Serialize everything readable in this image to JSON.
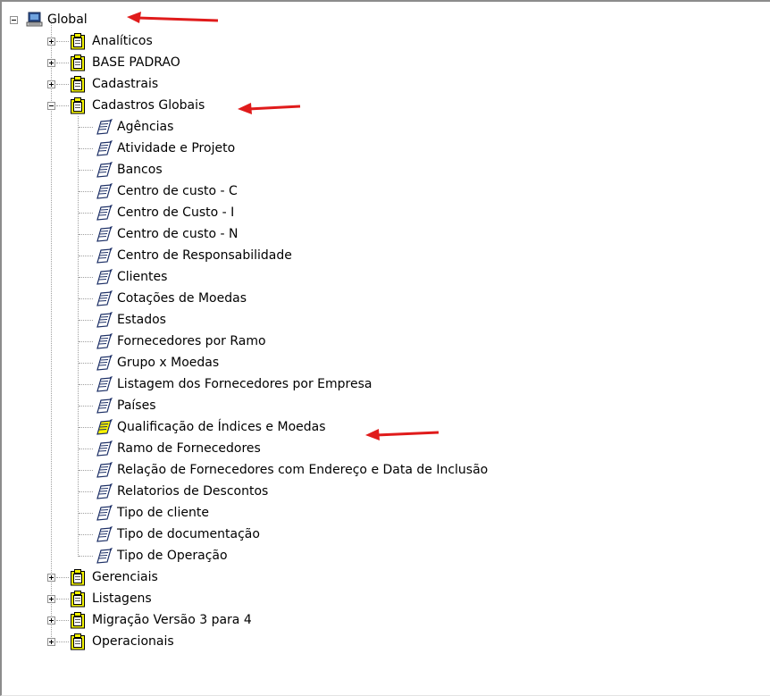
{
  "tree": {
    "root": {
      "label": "Global",
      "icon": "computer-icon",
      "expanded": true
    },
    "folders": [
      {
        "label": "Analíticos",
        "expanded": false
      },
      {
        "label": "BASE PADRAO",
        "expanded": false
      },
      {
        "label": "Cadastrais",
        "expanded": false
      },
      {
        "label": "Cadastros Globais",
        "expanded": true
      },
      {
        "label": "Gerenciais",
        "expanded": false
      },
      {
        "label": "Listagens",
        "expanded": false
      },
      {
        "label": "Migração Versão 3 para 4",
        "expanded": false
      },
      {
        "label": "Operacionais",
        "expanded": false
      }
    ],
    "reports": [
      "Agências",
      "Atividade e Projeto",
      "Bancos",
      "Centro de custo - C",
      "Centro de Custo - I",
      "Centro de custo - N",
      "Centro de Responsabilidade",
      "Clientes",
      "Cotações de Moedas",
      "Estados",
      "Fornecedores por Ramo",
      "Grupo x Moedas",
      "Listagem dos Fornecedores por Empresa",
      "Países",
      "Qualificação de Índices e Moedas",
      "Ramo de Fornecedores",
      "Relação de Fornecedores com Endereço e Data de Inclusão",
      "Relatorios de Descontos",
      "Tipo de cliente",
      "Tipo de documentação",
      "Tipo de Operação"
    ],
    "highlighted_report": "Qualificação de Índices e Moedas"
  },
  "colors": {
    "arrow": "#e01b1b",
    "folder_fill": "#f5f500",
    "tree_lines": "#a0a0a0"
  }
}
